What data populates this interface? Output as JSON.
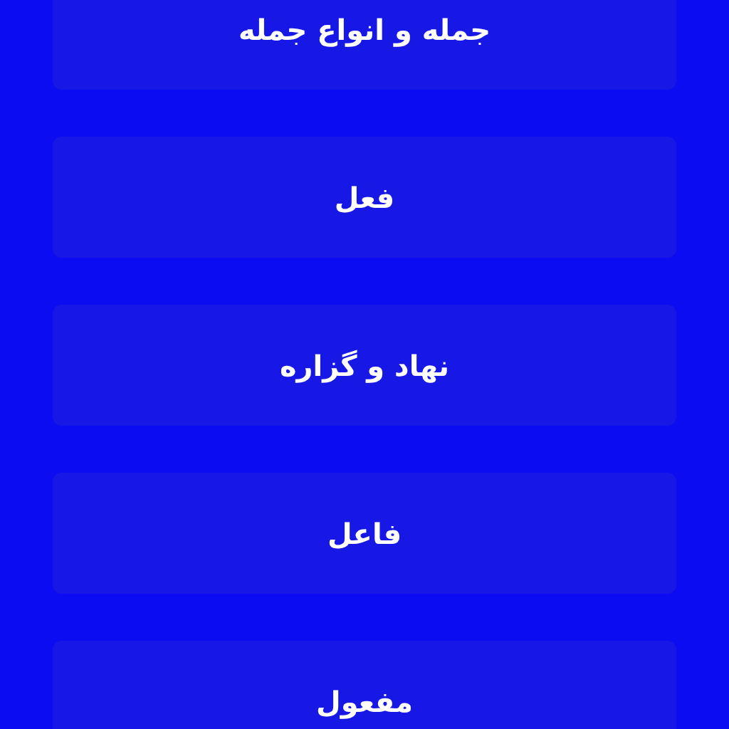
{
  "items": [
    {
      "label": "جمله و انواع جمله"
    },
    {
      "label": "فعل"
    },
    {
      "label": "نهاد و گزاره"
    },
    {
      "label": "فاعل"
    },
    {
      "label": "مفعول"
    }
  ]
}
